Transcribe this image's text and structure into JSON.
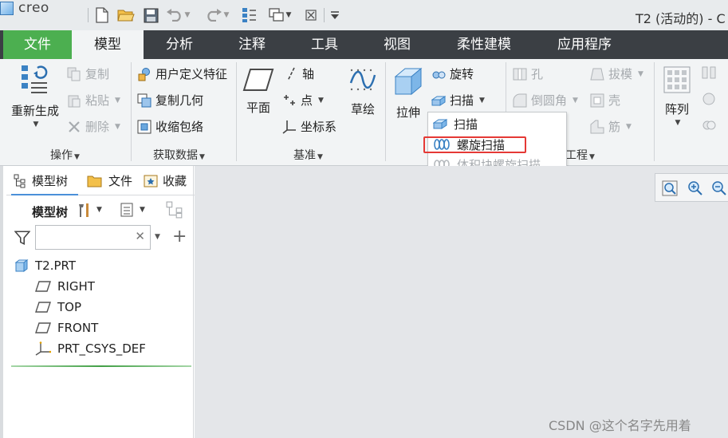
{
  "app": {
    "logo_text": "creo",
    "window_title": "T2 (活动的) - C"
  },
  "quick_access": {
    "icons": [
      "new-icon",
      "open-icon",
      "save-icon",
      "undo-icon",
      "redo-icon",
      "regenerate-icon",
      "windows-icon",
      "close-window-icon",
      "customize-icon"
    ]
  },
  "tabs": [
    {
      "label": "文件"
    },
    {
      "label": "模型"
    },
    {
      "label": "分析"
    },
    {
      "label": "注释"
    },
    {
      "label": "工具"
    },
    {
      "label": "视图"
    },
    {
      "label": "柔性建模"
    },
    {
      "label": "应用程序"
    }
  ],
  "ribbon": {
    "operations": {
      "regen_label": "重新生成",
      "copy_label": "复制",
      "paste_label": "粘贴",
      "delete_label": "删除",
      "group_label": "操作"
    },
    "get_data": {
      "udf_label": "用户定义特征",
      "copy_geom_label": "复制几何",
      "shrinkwrap_label": "收缩包络",
      "group_label": "获取数据"
    },
    "datum": {
      "plane_label": "平面",
      "axis_label": "轴",
      "point_label": "点",
      "csys_label": "坐标系",
      "sketch_label": "草绘",
      "group_label": "基准"
    },
    "shapes": {
      "extrude_label": "拉伸",
      "revolve_label": "旋转",
      "sweep_label": "扫描"
    },
    "engineering": {
      "hole_label": "孔",
      "round_label": "倒圆角",
      "draft_label": "拔模",
      "shell_label": "壳",
      "rib_label": "筋",
      "group_label": "工程"
    },
    "editing": {
      "pattern_label": "阵列"
    }
  },
  "sweep_menu": {
    "items": [
      {
        "label": "扫描",
        "enabled": true
      },
      {
        "label": "螺旋扫描",
        "enabled": true,
        "highlighted": true
      },
      {
        "label": "体积块螺旋扫描",
        "enabled": false
      }
    ]
  },
  "left_panel": {
    "tabs": [
      {
        "label": "模型树"
      },
      {
        "label": "文件"
      },
      {
        "label": "收藏"
      }
    ],
    "tree_title": "模型树",
    "search": {
      "value": "",
      "placeholder": ""
    },
    "tree": [
      {
        "label": "T2.PRT",
        "icon": "part-icon",
        "level": 0
      },
      {
        "label": "RIGHT",
        "icon": "datum-plane-icon",
        "level": 1
      },
      {
        "label": "TOP",
        "icon": "datum-plane-icon",
        "level": 1
      },
      {
        "label": "FRONT",
        "icon": "datum-plane-icon",
        "level": 1
      },
      {
        "label": "PRT_CSYS_DEF",
        "icon": "csys-icon",
        "level": 1
      }
    ]
  },
  "watermark": "CSDN @这个名字先用着",
  "colors": {
    "file_tab": "#4caf50",
    "tab_bar": "#3b3f44",
    "ribbon": "#f2f4f5",
    "highlight": "#e53935"
  }
}
